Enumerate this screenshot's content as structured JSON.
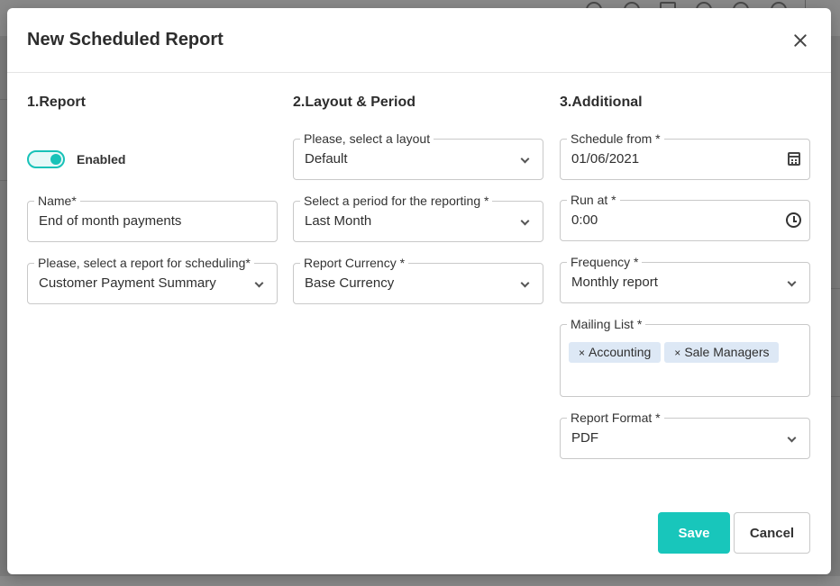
{
  "modal": {
    "title": "New Scheduled Report"
  },
  "sections": {
    "report": {
      "heading": "1.Report",
      "toggle_label": "Enabled",
      "enabled": true,
      "name_label": "Name*",
      "name_value": "End of month payments",
      "report_label": "Please, select a report for scheduling*",
      "report_value": "Customer Payment Summary"
    },
    "layout": {
      "heading": "2.Layout & Period",
      "layout_label": "Please, select a layout",
      "layout_value": "Default",
      "period_label": "Select a period for the reporting *",
      "period_value": "Last Month",
      "currency_label": "Report Currency *",
      "currency_value": "Base Currency"
    },
    "additional": {
      "heading": "3.Additional",
      "schedule_label": "Schedule from *",
      "schedule_value": "01/06/2021",
      "runat_label": "Run at *",
      "runat_value": "0:00",
      "frequency_label": "Frequency *",
      "frequency_value": "Monthly report",
      "mailing_label": "Mailing List *",
      "mailing_chips": [
        "Accounting",
        "Sale Managers"
      ],
      "format_label": "Report Format *",
      "format_value": "PDF"
    }
  },
  "buttons": {
    "save": "Save",
    "cancel": "Cancel"
  },
  "colors": {
    "accent": "#18c6bb"
  }
}
